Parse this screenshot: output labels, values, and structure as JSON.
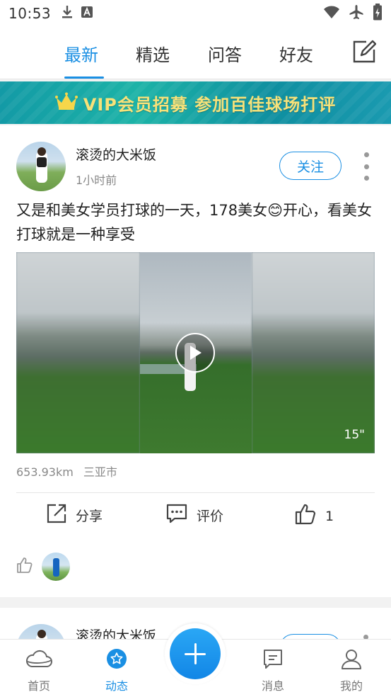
{
  "status_bar": {
    "time": "10:53",
    "icons": [
      "download-icon",
      "a-letter-icon",
      "wifi-icon",
      "airplane-mode-icon",
      "battery-charging-icon"
    ]
  },
  "top_tabs": {
    "items": [
      {
        "label": "最新",
        "active": true
      },
      {
        "label": "精选",
        "active": false
      },
      {
        "label": "问答",
        "active": false
      },
      {
        "label": "好友",
        "active": false
      }
    ],
    "edit_icon": "edit-icon"
  },
  "banner": {
    "text": "VIP会员招募 参加百佳球场打评",
    "icon": "crown-icon",
    "text_color": "#f7e27a"
  },
  "post": {
    "username": "滚烫的大米饭",
    "time": "1小时前",
    "follow_label": "关注",
    "content_before": "又是和美女学员打球的一天，178美女",
    "emoji": "😊",
    "content_after": "开心，看美女打球就是一种享受",
    "video_duration": "15\"",
    "distance": "653.93km",
    "location": "三亚市",
    "actions": {
      "share_label": "分享",
      "comment_label": "评价",
      "like_count": "1"
    }
  },
  "post2": {
    "username": "滚烫的大米饭"
  },
  "bottom_nav": {
    "items": [
      {
        "label": "首页",
        "icon": "cloud-icon",
        "active": false
      },
      {
        "label": "动态",
        "icon": "star-circle-icon",
        "active": true
      },
      {
        "label": "消息",
        "icon": "message-icon",
        "active": false
      },
      {
        "label": "我的",
        "icon": "user-icon",
        "active": false
      }
    ],
    "fab_icon": "plus-icon"
  },
  "colors": {
    "accent": "#1a8fe3",
    "text": "#222222",
    "muted": "#888888"
  }
}
